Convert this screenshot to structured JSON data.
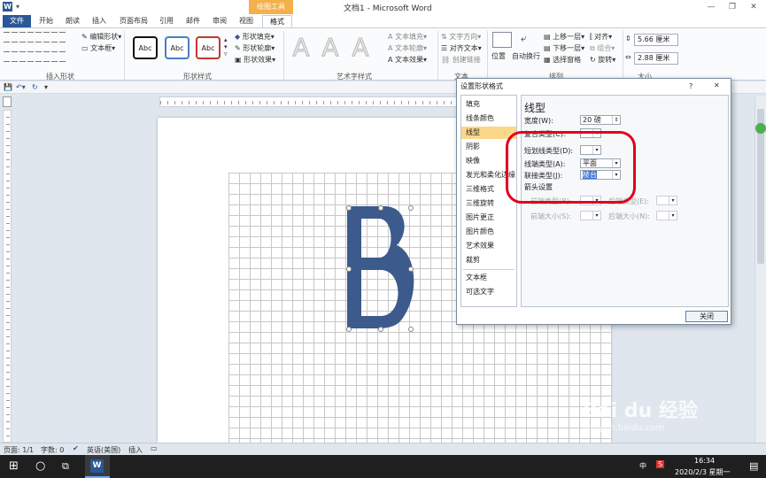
{
  "app": {
    "title": "文档1 - Microsoft Word",
    "context_tab": "绘图工具",
    "window_buttons": [
      "—",
      "❐",
      "✕"
    ]
  },
  "tabs": [
    "文件",
    "开始",
    "朗读",
    "插入",
    "页面布局",
    "引用",
    "邮件",
    "审阅",
    "视图",
    "格式"
  ],
  "ribbon": {
    "groups": [
      "插入形状",
      "形状样式",
      "艺术字样式",
      "文本",
      "排列",
      "大小"
    ],
    "edit_shape": "编辑形状",
    "text_box": "文本框",
    "style_labels": [
      "Abc",
      "Abc",
      "Abc"
    ],
    "shape_fill": "形状填充",
    "shape_outline": "形状轮廓",
    "shape_effect": "形状效果",
    "wordart_letter": "A",
    "text_fill": "文本填充",
    "text_outline": "文本轮廓",
    "text_effect": "文本效果",
    "text_direction": "文字方向",
    "align_text": "对齐文本",
    "create_link": "创建链接",
    "position": "位置",
    "wrap": "自动换行",
    "bring_forward": "上移一层",
    "send_backward": "下移一层",
    "selection_pane": "选择窗格",
    "align": "对齐",
    "group": "组合",
    "rotate": "旋转",
    "height": "5.66 厘米",
    "width": "2.88 厘米"
  },
  "dialog": {
    "title": "设置形状格式",
    "help": "?",
    "close_x": "✕",
    "nav": [
      "填充",
      "线条颜色",
      "线型",
      "阴影",
      "映像",
      "发光和柔化边缘",
      "三维格式",
      "三维旋转",
      "图片更正",
      "图片颜色",
      "艺术效果",
      "裁剪",
      "文本框",
      "可选文字"
    ],
    "selected_nav": "线型",
    "pane_title": "线型",
    "width_label": "宽度(W):",
    "width_value": "20 磅",
    "compound_label": "复合类型(C):",
    "dash_label": "短划线类型(D):",
    "cap_label": "线端类型(A):",
    "cap_value": "平面",
    "join_label": "联接类型(J):",
    "join_value": "棱台",
    "arrow_settings": "箭头设置",
    "begin_type": "前端类型(B):",
    "end_type": "后端类型(E):",
    "begin_size": "前端大小(S):",
    "end_size": "后端大小(N):",
    "close_button": "关闭"
  },
  "status": {
    "page": "页面: 1/1",
    "words": "字数: 0",
    "language": "英语(美国)",
    "mode": "插入"
  },
  "taskbar": {
    "time": "16:34",
    "date": "2020/2/3 星期一",
    "ime": "中",
    "word_icon": "W"
  },
  "watermark": {
    "brand": "Bai du 经验",
    "url": "jingyan.baidu.com"
  },
  "colors": {
    "shape_fill": "#3c5a8c",
    "highlight_circle": "#e1001e",
    "selected_nav": "#fbd889",
    "file_tab": "#2b5797"
  }
}
